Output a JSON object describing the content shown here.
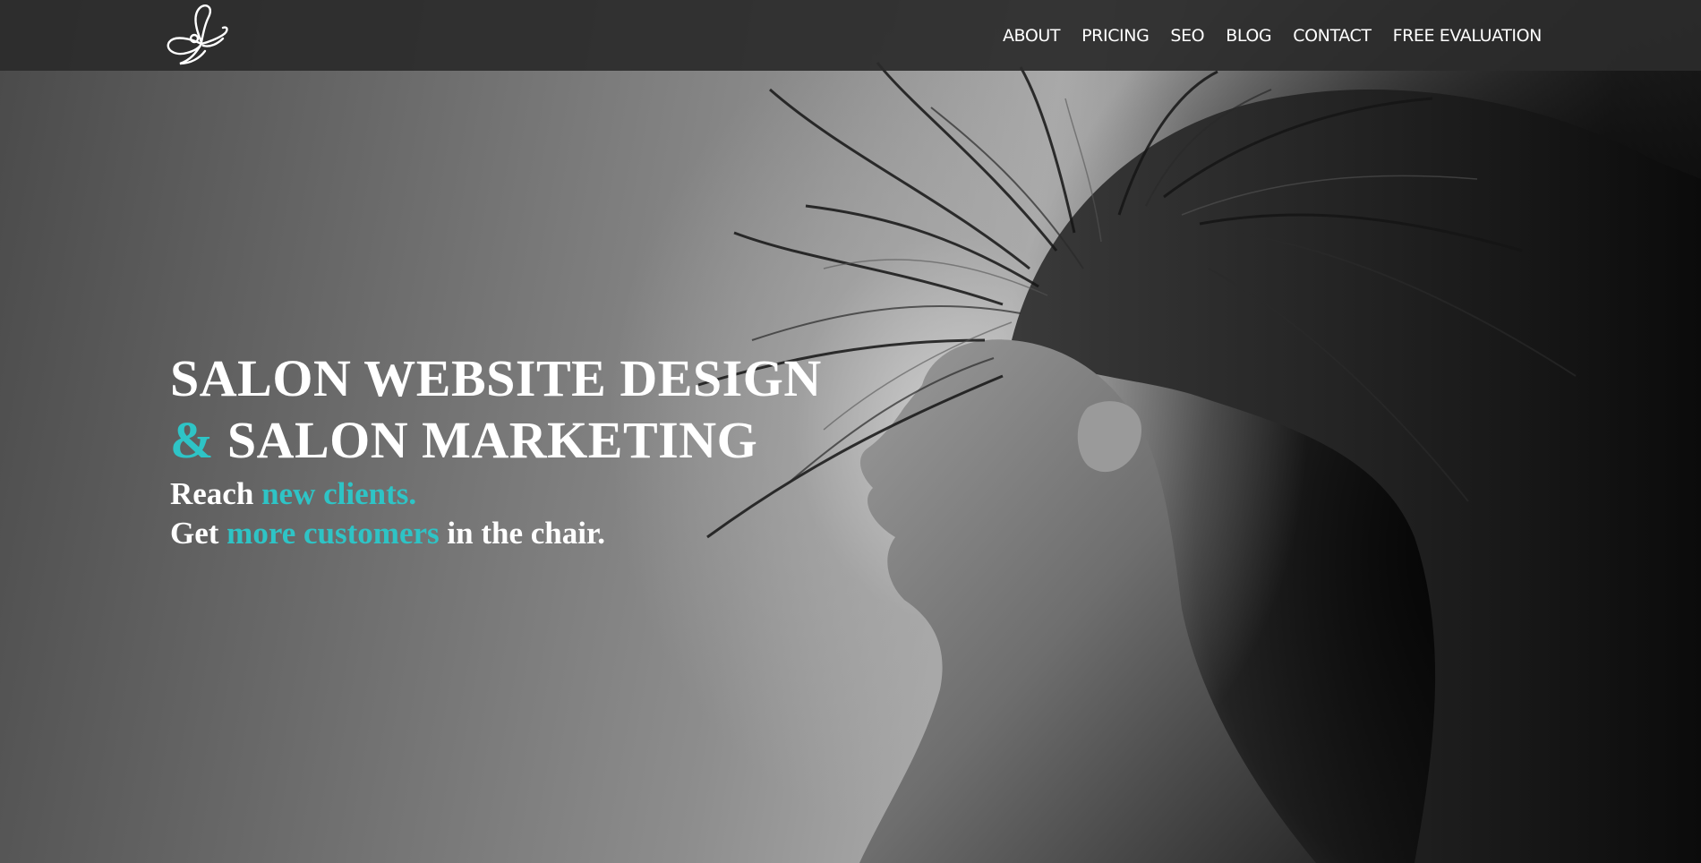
{
  "nav": {
    "logo_icon": "butterfly-script-logo",
    "items": [
      {
        "label": "ABOUT"
      },
      {
        "label": "PRICING"
      },
      {
        "label": "SEO"
      },
      {
        "label": "BLOG"
      },
      {
        "label": "CONTACT"
      },
      {
        "label": "FREE EVALUATION"
      }
    ]
  },
  "hero": {
    "headline_line1": "SALON WEBSITE DESIGN",
    "headline_line2_accent": "&",
    "headline_line2_rest": " SALON MARKETING",
    "tagline_line1_start": "Reach ",
    "tagline_line1_accent": "new clients.",
    "tagline_line2_start": "Get ",
    "tagline_line2_accent": "more customers",
    "tagline_line2_end": " in the chair.",
    "image": "black-and-white-woman-hair-flip-photo"
  },
  "colors": {
    "accent": "#2ec4c6",
    "navbar": "#2b2b2b",
    "text": "#ffffff"
  }
}
